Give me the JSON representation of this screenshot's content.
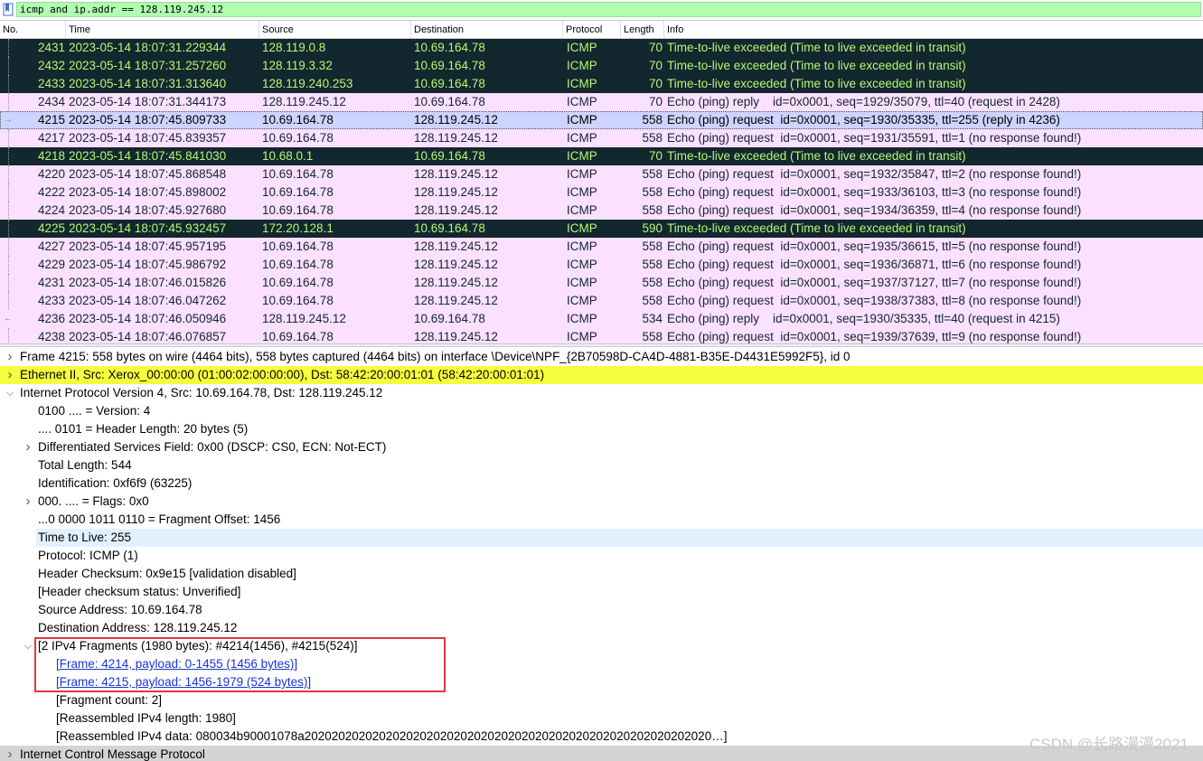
{
  "filter": {
    "text": "icmp and ip.addr == 128.119.245.12",
    "icon": "bookmark-icon"
  },
  "columns": [
    "No.",
    "Time",
    "Source",
    "Destination",
    "Protocol",
    "Length",
    "Info"
  ],
  "colors": {
    "ttl_bg": "#12272e",
    "ttl_fg": "#b7f774",
    "icmp_bg": "#fce0ff",
    "icmp_fg": "#12272e",
    "selected_bg": "#ccd4ff",
    "selected_fg": "#000000",
    "highlight_bg": "#f5ff3d",
    "field_highlight_bg": "#e2f1ff",
    "frag_box": "#e0383a",
    "filter_bg": "#afffaf"
  },
  "packets": [
    {
      "no": "2431",
      "time": "2023-05-14 18:07:31.229344",
      "src": "128.119.0.8",
      "dst": "10.69.164.78",
      "proto": "ICMP",
      "len": "70",
      "info": "Time-to-live exceeded (Time to live exceeded in transit)",
      "style": "ttl",
      "marker": "line"
    },
    {
      "no": "2432",
      "time": "2023-05-14 18:07:31.257260",
      "src": "128.119.3.32",
      "dst": "10.69.164.78",
      "proto": "ICMP",
      "len": "70",
      "info": "Time-to-live exceeded (Time to live exceeded in transit)",
      "style": "ttl",
      "marker": "line"
    },
    {
      "no": "2433",
      "time": "2023-05-14 18:07:31.313640",
      "src": "128.119.240.253",
      "dst": "10.69.164.78",
      "proto": "ICMP",
      "len": "70",
      "info": "Time-to-live exceeded (Time to live exceeded in transit)",
      "style": "ttl",
      "marker": "line"
    },
    {
      "no": "2434",
      "time": "2023-05-14 18:07:31.344173",
      "src": "128.119.245.12",
      "dst": "10.69.164.78",
      "proto": "ICMP",
      "len": "70",
      "info": "Echo (ping) reply    id=0x0001, seq=1929/35079, ttl=40 (request in 2428)",
      "style": "icmp",
      "marker": "line"
    },
    {
      "no": "4215",
      "time": "2023-05-14 18:07:45.809733",
      "src": "10.69.164.78",
      "dst": "128.119.245.12",
      "proto": "ICMP",
      "len": "558",
      "info": "Echo (ping) request  id=0x0001, seq=1930/35335, ttl=255 (reply in 4236)",
      "style": "selected",
      "marker": "right"
    },
    {
      "no": "4217",
      "time": "2023-05-14 18:07:45.839357",
      "src": "10.69.164.78",
      "dst": "128.119.245.12",
      "proto": "ICMP",
      "len": "558",
      "info": "Echo (ping) request  id=0x0001, seq=1931/35591, ttl=1 (no response found!)",
      "style": "icmp",
      "marker": "line"
    },
    {
      "no": "4218",
      "time": "2023-05-14 18:07:45.841030",
      "src": "10.68.0.1",
      "dst": "10.69.164.78",
      "proto": "ICMP",
      "len": "70",
      "info": "Time-to-live exceeded (Time to live exceeded in transit)",
      "style": "ttl",
      "marker": "line"
    },
    {
      "no": "4220",
      "time": "2023-05-14 18:07:45.868548",
      "src": "10.69.164.78",
      "dst": "128.119.245.12",
      "proto": "ICMP",
      "len": "558",
      "info": "Echo (ping) request  id=0x0001, seq=1932/35847, ttl=2 (no response found!)",
      "style": "icmp",
      "marker": "line"
    },
    {
      "no": "4222",
      "time": "2023-05-14 18:07:45.898002",
      "src": "10.69.164.78",
      "dst": "128.119.245.12",
      "proto": "ICMP",
      "len": "558",
      "info": "Echo (ping) request  id=0x0001, seq=1933/36103, ttl=3 (no response found!)",
      "style": "icmp",
      "marker": "line"
    },
    {
      "no": "4224",
      "time": "2023-05-14 18:07:45.927680",
      "src": "10.69.164.78",
      "dst": "128.119.245.12",
      "proto": "ICMP",
      "len": "558",
      "info": "Echo (ping) request  id=0x0001, seq=1934/36359, ttl=4 (no response found!)",
      "style": "icmp",
      "marker": "line"
    },
    {
      "no": "4225",
      "time": "2023-05-14 18:07:45.932457",
      "src": "172.20.128.1",
      "dst": "10.69.164.78",
      "proto": "ICMP",
      "len": "590",
      "info": "Time-to-live exceeded (Time to live exceeded in transit)",
      "style": "ttl",
      "marker": "line"
    },
    {
      "no": "4227",
      "time": "2023-05-14 18:07:45.957195",
      "src": "10.69.164.78",
      "dst": "128.119.245.12",
      "proto": "ICMP",
      "len": "558",
      "info": "Echo (ping) request  id=0x0001, seq=1935/36615, ttl=5 (no response found!)",
      "style": "icmp",
      "marker": "line"
    },
    {
      "no": "4229",
      "time": "2023-05-14 18:07:45.986792",
      "src": "10.69.164.78",
      "dst": "128.119.245.12",
      "proto": "ICMP",
      "len": "558",
      "info": "Echo (ping) request  id=0x0001, seq=1936/36871, ttl=6 (no response found!)",
      "style": "icmp",
      "marker": "line"
    },
    {
      "no": "4231",
      "time": "2023-05-14 18:07:46.015826",
      "src": "10.69.164.78",
      "dst": "128.119.245.12",
      "proto": "ICMP",
      "len": "558",
      "info": "Echo (ping) request  id=0x0001, seq=1937/37127, ttl=7 (no response found!)",
      "style": "icmp",
      "marker": "line"
    },
    {
      "no": "4233",
      "time": "2023-05-14 18:07:46.047262",
      "src": "10.69.164.78",
      "dst": "128.119.245.12",
      "proto": "ICMP",
      "len": "558",
      "info": "Echo (ping) request  id=0x0001, seq=1938/37383, ttl=8 (no response found!)",
      "style": "icmp",
      "marker": "line"
    },
    {
      "no": "4236",
      "time": "2023-05-14 18:07:46.050946",
      "src": "128.119.245.12",
      "dst": "10.69.164.78",
      "proto": "ICMP",
      "len": "534",
      "info": "Echo (ping) reply    id=0x0001, seq=1930/35335, ttl=40 (request in 4215)",
      "style": "icmp",
      "marker": "left"
    },
    {
      "no": "4238",
      "time": "2023-05-14 18:07:46.076857",
      "src": "10.69.164.78",
      "dst": "128.119.245.12",
      "proto": "ICMP",
      "len": "558",
      "info": "Echo (ping) request  id=0x0001, seq=1939/37639, ttl=9 (no response found!)",
      "style": "icmp",
      "marker": "line"
    }
  ],
  "details": [
    {
      "text": "Frame 4215: 558 bytes on wire (4464 bits), 558 bytes captured (4464 bits) on interface \\Device\\NPF_{2B70598D-CA4D-4881-B35E-D4431E5992F5}, id 0",
      "indent": 0,
      "toggle": "collapsed",
      "style": "normal"
    },
    {
      "text": "Ethernet II, Src: Xerox_00:00:00 (01:00:02:00:00:00), Dst: 58:42:20:00:01:01 (58:42:20:00:01:01)",
      "indent": 0,
      "toggle": "collapsed",
      "style": "yellow"
    },
    {
      "text": "Internet Protocol Version 4, Src: 10.69.164.78, Dst: 128.119.245.12",
      "indent": 0,
      "toggle": "expanded",
      "style": "normal"
    },
    {
      "text": "0100 .... = Version: 4",
      "indent": 1,
      "toggle": "none",
      "style": "normal"
    },
    {
      "text": ".... 0101 = Header Length: 20 bytes (5)",
      "indent": 1,
      "toggle": "none",
      "style": "normal"
    },
    {
      "text": "Differentiated Services Field: 0x00 (DSCP: CS0, ECN: Not-ECT)",
      "indent": 1,
      "toggle": "collapsed",
      "style": "normal"
    },
    {
      "text": "Total Length: 544",
      "indent": 1,
      "toggle": "none",
      "style": "normal"
    },
    {
      "text": "Identification: 0xf6f9 (63225)",
      "indent": 1,
      "toggle": "none",
      "style": "normal"
    },
    {
      "text": "000. .... = Flags: 0x0",
      "indent": 1,
      "toggle": "collapsed",
      "style": "normal"
    },
    {
      "text": "...0 0000 1011 0110 = Fragment Offset: 1456",
      "indent": 1,
      "toggle": "none",
      "style": "normal"
    },
    {
      "text": "Time to Live: 255",
      "indent": 1,
      "toggle": "none",
      "style": "field"
    },
    {
      "text": "Protocol: ICMP (1)",
      "indent": 1,
      "toggle": "none",
      "style": "normal"
    },
    {
      "text": "Header Checksum: 0x9e15 [validation disabled]",
      "indent": 1,
      "toggle": "none",
      "style": "normal"
    },
    {
      "text": "[Header checksum status: Unverified]",
      "indent": 1,
      "toggle": "none",
      "style": "normal"
    },
    {
      "text": "Source Address: 10.69.164.78",
      "indent": 1,
      "toggle": "none",
      "style": "normal"
    },
    {
      "text": "Destination Address: 128.119.245.12",
      "indent": 1,
      "toggle": "none",
      "style": "normal"
    },
    {
      "text": "[2 IPv4 Fragments (1980 bytes): #4214(1456), #4215(524)]",
      "indent": 1,
      "toggle": "expanded",
      "style": "normal"
    },
    {
      "text": "[Frame: 4214, payload: 0-1455 (1456 bytes)]",
      "indent": 2,
      "toggle": "none",
      "style": "link"
    },
    {
      "text": "[Frame: 4215, payload: 1456-1979 (524 bytes)]",
      "indent": 2,
      "toggle": "none",
      "style": "link"
    },
    {
      "text": "[Fragment count: 2]",
      "indent": 2,
      "toggle": "none",
      "style": "normal"
    },
    {
      "text": "[Reassembled IPv4 length: 1980]",
      "indent": 2,
      "toggle": "none",
      "style": "normal"
    },
    {
      "text": "[Reassembled IPv4 data: 080034b90001078a202020202020202020202020202020202020202020202020202020202020…]",
      "indent": 2,
      "toggle": "none",
      "style": "normal"
    },
    {
      "text": "Internet Control Message Protocol",
      "indent": 0,
      "toggle": "collapsed",
      "style": "grey"
    }
  ],
  "watermark": "CSDN @长路漫漫2021"
}
